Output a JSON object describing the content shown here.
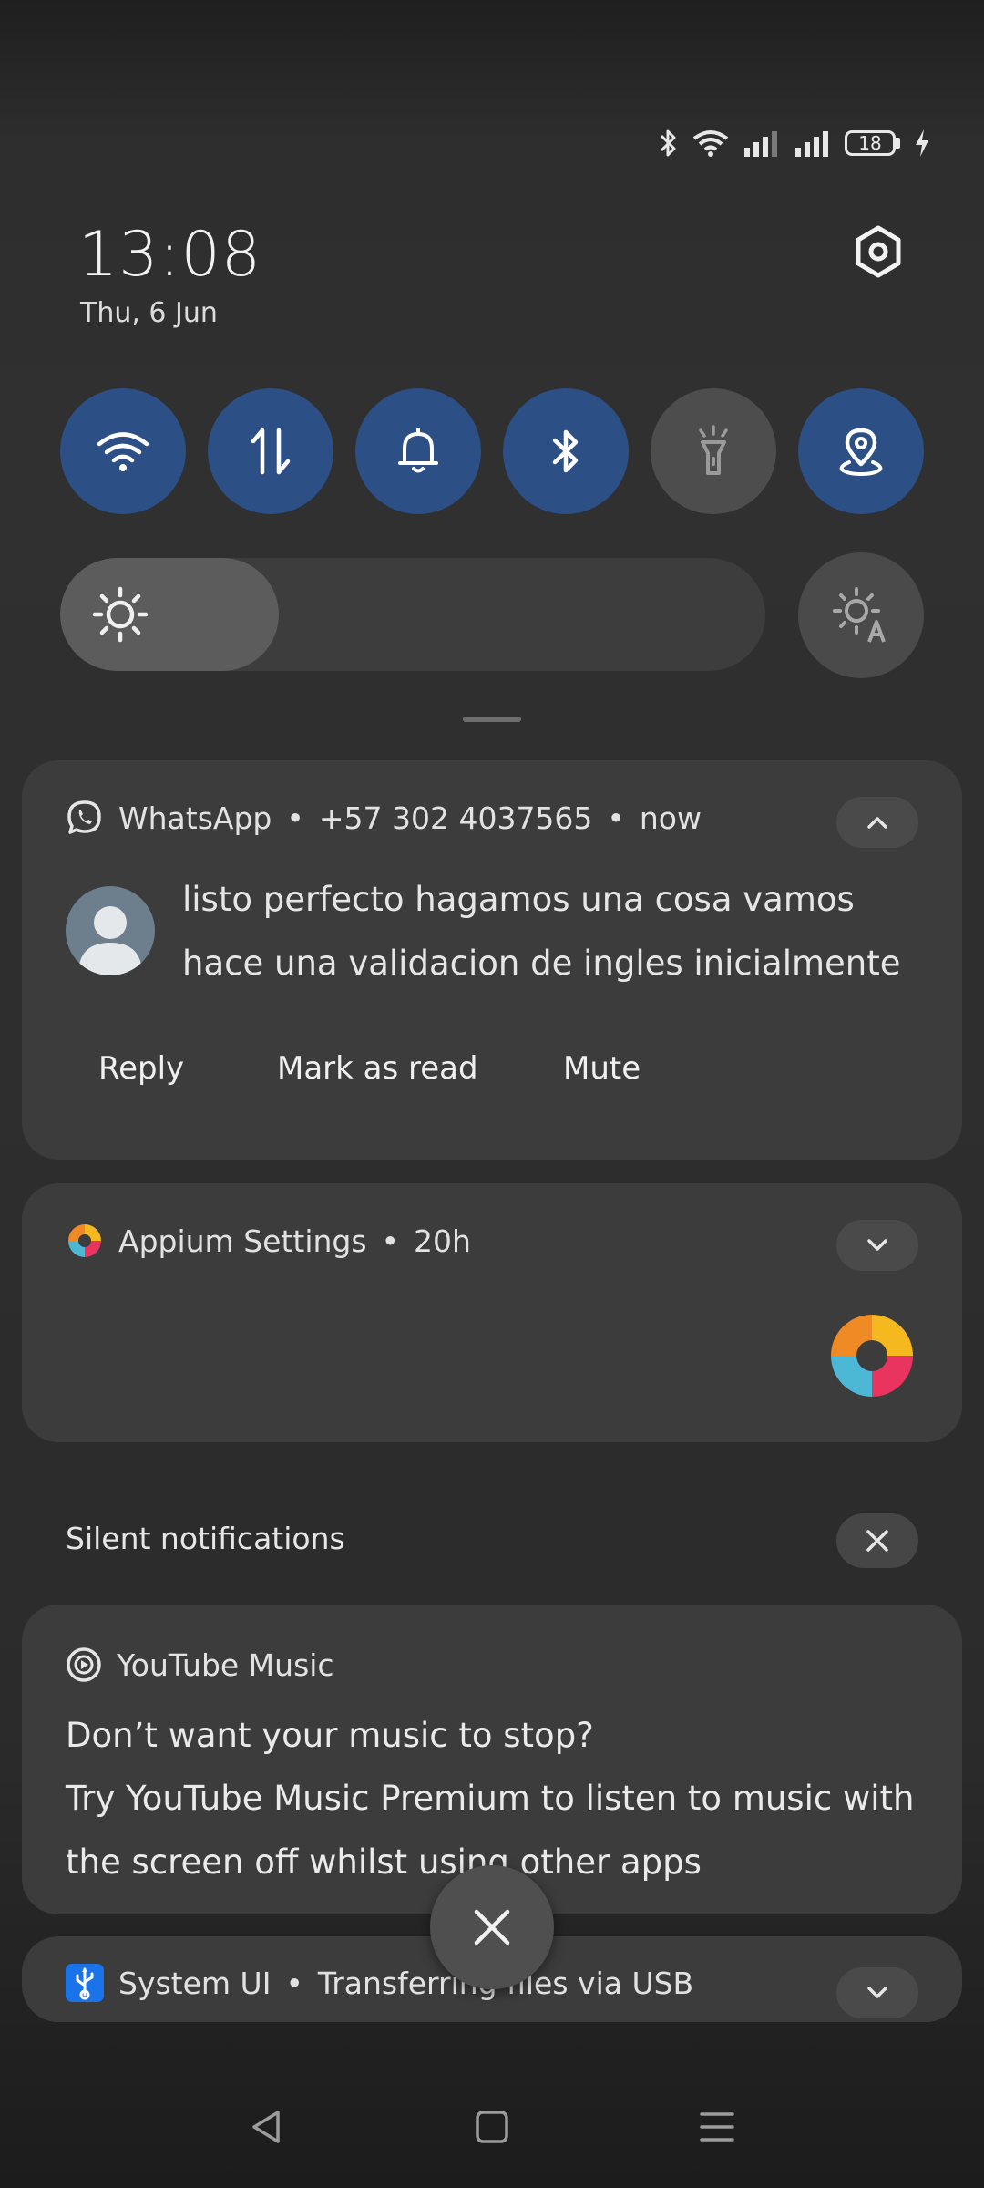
{
  "status_bar": {
    "battery_level": "18"
  },
  "header": {
    "time": "13:08",
    "date": "Thu, 6 Jun"
  },
  "quick_tiles": [
    {
      "name": "wifi",
      "icon": "wifi-icon",
      "active": true
    },
    {
      "name": "mobile-data",
      "icon": "data-arrows-icon",
      "active": true
    },
    {
      "name": "sound",
      "icon": "bell-icon",
      "active": true
    },
    {
      "name": "bluetooth",
      "icon": "bluetooth-icon",
      "active": true
    },
    {
      "name": "flashlight",
      "icon": "flashlight-icon",
      "active": false
    },
    {
      "name": "location",
      "icon": "location-icon",
      "active": true
    }
  ],
  "brightness": {
    "level": 0.31,
    "icon": "sun-icon",
    "auto_icon": "auto-brightness-icon"
  },
  "colors": {
    "tile_active": "#2c4f86",
    "tile_inactive": "#4d4d4d",
    "card_bg": "#3c3c3c"
  },
  "notifications": {
    "whatsapp": {
      "app": "WhatsApp",
      "sender": "+57 302 4037565",
      "time": "now",
      "message": "listo perfecto hagamos una cosa vamos hace una validacion de ingles inicialmente",
      "actions": {
        "reply": "Reply",
        "mark_read": "Mark as read",
        "mute": "Mute"
      }
    },
    "appium": {
      "app": "Appium Settings",
      "time": "20h"
    },
    "silent_label": "Silent notifications",
    "youtube": {
      "app": "YouTube Music",
      "title": "Don’t want your music to stop?",
      "body": "Try YouTube Music Premium to listen to music with the screen off whilst using other apps"
    },
    "systemui": {
      "app": "System UI",
      "text": "Transferring files via USB"
    }
  },
  "separator": "•"
}
